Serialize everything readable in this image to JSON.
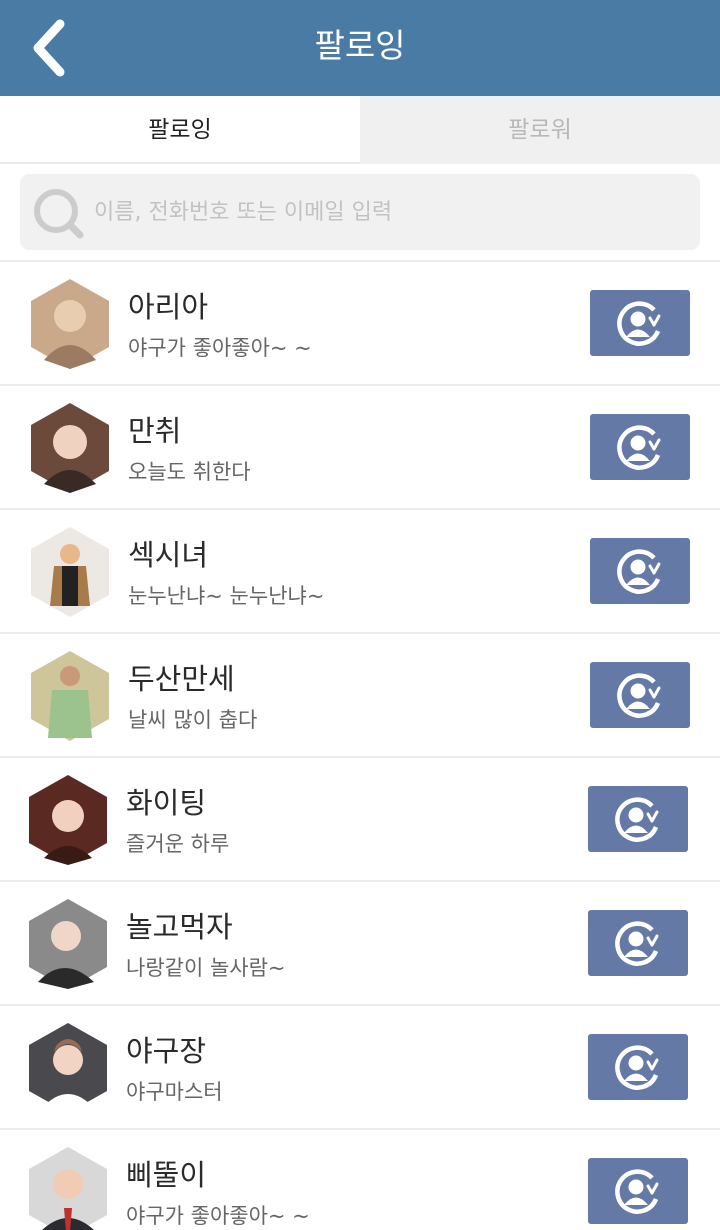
{
  "header": {
    "title": "팔로잉",
    "back_icon": "chevron-left-icon",
    "color": "#4a7ba5"
  },
  "tabs": [
    {
      "label": "팔로잉",
      "active": true
    },
    {
      "label": "팔로워",
      "active": false
    }
  ],
  "search": {
    "placeholder": "이름, 전화번호 또는 이메일 입력",
    "value": "",
    "icon": "search-icon"
  },
  "follow_button": {
    "icon": "user-check-icon",
    "color": "#6479a6"
  },
  "users": [
    {
      "name": "아리아",
      "status": "야구가 좋아좋아~ ~",
      "avatar_tone": "#c9a98a"
    },
    {
      "name": "만취",
      "status": "오늘도 취한다",
      "avatar_tone": "#6b4a3c"
    },
    {
      "name": "섹시녀",
      "status": "눈누난냐~ 눈누난냐~",
      "avatar_tone": "#a87b4a"
    },
    {
      "name": "두산만세",
      "status": "날씨 많이 춥다",
      "avatar_tone": "#cfc59a"
    },
    {
      "name": "화이팅",
      "status": "즐거운 하루",
      "avatar_tone": "#5a2a22"
    },
    {
      "name": "놀고먹자",
      "status": "나랑같이 놀사람~",
      "avatar_tone": "#8a8a8a"
    },
    {
      "name": "야구장",
      "status": "야구마스터",
      "avatar_tone": "#9a6b55"
    },
    {
      "name": "삐뚤이",
      "status": "야구가 좋아좋아~ ~",
      "avatar_tone": "#d8d8d8"
    }
  ]
}
